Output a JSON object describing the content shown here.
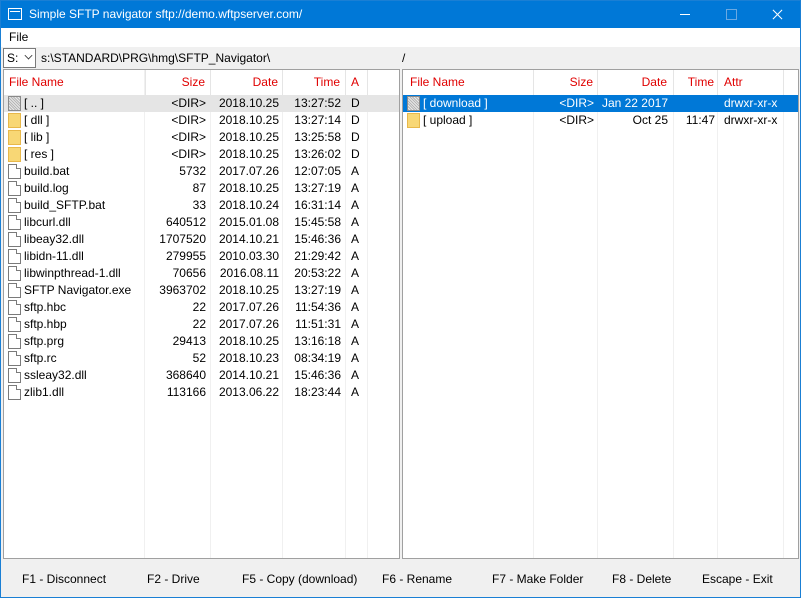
{
  "window": {
    "title": "Simple SFTP navigator sftp://demo.wftpserver.com/"
  },
  "menu": {
    "file_label": "File"
  },
  "pathbar": {
    "drive": "S:",
    "left_path": "s:\\STANDARD\\PRG\\hmg\\SFTP_Navigator\\",
    "right_path": "/"
  },
  "left_panel": {
    "headers": {
      "name": "File Name",
      "size": "Size",
      "date": "Date",
      "time": "Time",
      "attr": "A"
    },
    "rows": [
      {
        "name": "[ .. ]",
        "size": "<DIR>",
        "date": "2018.10.25",
        "time": "13:27:52",
        "attr": "D",
        "icon": "parent-folder-icon"
      },
      {
        "name": "[ dll ]",
        "size": "<DIR>",
        "date": "2018.10.25",
        "time": "13:27:14",
        "attr": "D",
        "icon": "folder-icon"
      },
      {
        "name": "[ lib ]",
        "size": "<DIR>",
        "date": "2018.10.25",
        "time": "13:25:58",
        "attr": "D",
        "icon": "folder-icon"
      },
      {
        "name": "[ res ]",
        "size": "<DIR>",
        "date": "2018.10.25",
        "time": "13:26:02",
        "attr": "D",
        "icon": "folder-icon"
      },
      {
        "name": "build.bat",
        "size": "5732",
        "date": "2017.07.26",
        "time": "12:07:05",
        "attr": "A",
        "icon": "file-icon"
      },
      {
        "name": "build.log",
        "size": "87",
        "date": "2018.10.25",
        "time": "13:27:19",
        "attr": "A",
        "icon": "file-icon"
      },
      {
        "name": "build_SFTP.bat",
        "size": "33",
        "date": "2018.10.24",
        "time": "16:31:14",
        "attr": "A",
        "icon": "file-icon"
      },
      {
        "name": "libcurl.dll",
        "size": "640512",
        "date": "2015.01.08",
        "time": "15:45:58",
        "attr": "A",
        "icon": "file-icon"
      },
      {
        "name": "libeay32.dll",
        "size": "1707520",
        "date": "2014.10.21",
        "time": "15:46:36",
        "attr": "A",
        "icon": "file-icon"
      },
      {
        "name": "libidn-11.dll",
        "size": "279955",
        "date": "2010.03.30",
        "time": "21:29:42",
        "attr": "A",
        "icon": "file-icon"
      },
      {
        "name": "libwinpthread-1.dll",
        "size": "70656",
        "date": "2016.08.11",
        "time": "20:53:22",
        "attr": "A",
        "icon": "file-icon"
      },
      {
        "name": "SFTP Navigator.exe",
        "size": "3963702",
        "date": "2018.10.25",
        "time": "13:27:19",
        "attr": "A",
        "icon": "file-icon"
      },
      {
        "name": "sftp.hbc",
        "size": "22",
        "date": "2017.07.26",
        "time": "11:54:36",
        "attr": "A",
        "icon": "file-icon"
      },
      {
        "name": "sftp.hbp",
        "size": "22",
        "date": "2017.07.26",
        "time": "11:51:31",
        "attr": "A",
        "icon": "file-icon"
      },
      {
        "name": "sftp.prg",
        "size": "29413",
        "date": "2018.10.25",
        "time": "13:16:18",
        "attr": "A",
        "icon": "file-icon"
      },
      {
        "name": "sftp.rc",
        "size": "52",
        "date": "2018.10.23",
        "time": "08:34:19",
        "attr": "A",
        "icon": "file-icon"
      },
      {
        "name": "ssleay32.dll",
        "size": "368640",
        "date": "2014.10.21",
        "time": "15:46:36",
        "attr": "A",
        "icon": "file-icon"
      },
      {
        "name": "zlib1.dll",
        "size": "113166",
        "date": "2013.06.22",
        "time": "18:23:44",
        "attr": "A",
        "icon": "file-icon"
      }
    ]
  },
  "right_panel": {
    "headers": {
      "name": "File Name",
      "size": "Size",
      "date": "Date",
      "time": "Time",
      "attr": "Attr"
    },
    "rows": [
      {
        "name": "[ download ]",
        "size": "<DIR>",
        "date": "Jan 22 2017",
        "time": "",
        "attr": "drwxr-xr-x",
        "icon": "folder-icon"
      },
      {
        "name": "[ upload ]",
        "size": "<DIR>",
        "date": "Oct 25",
        "time": "11:47",
        "attr": "drwxr-xr-x",
        "icon": "folder-icon"
      }
    ]
  },
  "fkeys": [
    "F1 - Disconnect",
    "F2 - Drive",
    "F5 - Copy (download)",
    "F6 - Rename",
    "F7 - Make Folder",
    "F8 - Delete",
    "Escape - Exit"
  ]
}
